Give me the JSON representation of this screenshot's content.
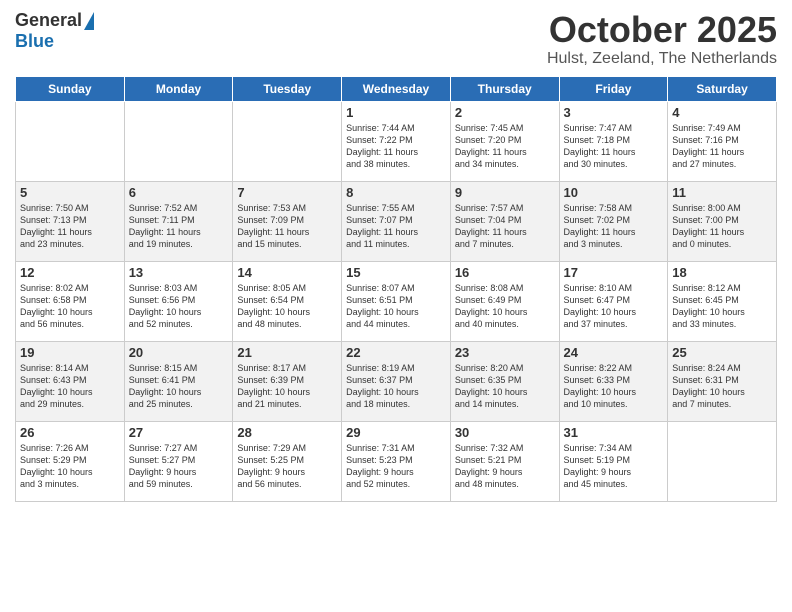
{
  "header": {
    "logo_general": "General",
    "logo_blue": "Blue",
    "month_title": "October 2025",
    "location": "Hulst, Zeeland, The Netherlands"
  },
  "days_of_week": [
    "Sunday",
    "Monday",
    "Tuesday",
    "Wednesday",
    "Thursday",
    "Friday",
    "Saturday"
  ],
  "weeks": [
    [
      {
        "day": "",
        "info": ""
      },
      {
        "day": "",
        "info": ""
      },
      {
        "day": "",
        "info": ""
      },
      {
        "day": "1",
        "info": "Sunrise: 7:44 AM\nSunset: 7:22 PM\nDaylight: 11 hours\nand 38 minutes."
      },
      {
        "day": "2",
        "info": "Sunrise: 7:45 AM\nSunset: 7:20 PM\nDaylight: 11 hours\nand 34 minutes."
      },
      {
        "day": "3",
        "info": "Sunrise: 7:47 AM\nSunset: 7:18 PM\nDaylight: 11 hours\nand 30 minutes."
      },
      {
        "day": "4",
        "info": "Sunrise: 7:49 AM\nSunset: 7:16 PM\nDaylight: 11 hours\nand 27 minutes."
      }
    ],
    [
      {
        "day": "5",
        "info": "Sunrise: 7:50 AM\nSunset: 7:13 PM\nDaylight: 11 hours\nand 23 minutes."
      },
      {
        "day": "6",
        "info": "Sunrise: 7:52 AM\nSunset: 7:11 PM\nDaylight: 11 hours\nand 19 minutes."
      },
      {
        "day": "7",
        "info": "Sunrise: 7:53 AM\nSunset: 7:09 PM\nDaylight: 11 hours\nand 15 minutes."
      },
      {
        "day": "8",
        "info": "Sunrise: 7:55 AM\nSunset: 7:07 PM\nDaylight: 11 hours\nand 11 minutes."
      },
      {
        "day": "9",
        "info": "Sunrise: 7:57 AM\nSunset: 7:04 PM\nDaylight: 11 hours\nand 7 minutes."
      },
      {
        "day": "10",
        "info": "Sunrise: 7:58 AM\nSunset: 7:02 PM\nDaylight: 11 hours\nand 3 minutes."
      },
      {
        "day": "11",
        "info": "Sunrise: 8:00 AM\nSunset: 7:00 PM\nDaylight: 11 hours\nand 0 minutes."
      }
    ],
    [
      {
        "day": "12",
        "info": "Sunrise: 8:02 AM\nSunset: 6:58 PM\nDaylight: 10 hours\nand 56 minutes."
      },
      {
        "day": "13",
        "info": "Sunrise: 8:03 AM\nSunset: 6:56 PM\nDaylight: 10 hours\nand 52 minutes."
      },
      {
        "day": "14",
        "info": "Sunrise: 8:05 AM\nSunset: 6:54 PM\nDaylight: 10 hours\nand 48 minutes."
      },
      {
        "day": "15",
        "info": "Sunrise: 8:07 AM\nSunset: 6:51 PM\nDaylight: 10 hours\nand 44 minutes."
      },
      {
        "day": "16",
        "info": "Sunrise: 8:08 AM\nSunset: 6:49 PM\nDaylight: 10 hours\nand 40 minutes."
      },
      {
        "day": "17",
        "info": "Sunrise: 8:10 AM\nSunset: 6:47 PM\nDaylight: 10 hours\nand 37 minutes."
      },
      {
        "day": "18",
        "info": "Sunrise: 8:12 AM\nSunset: 6:45 PM\nDaylight: 10 hours\nand 33 minutes."
      }
    ],
    [
      {
        "day": "19",
        "info": "Sunrise: 8:14 AM\nSunset: 6:43 PM\nDaylight: 10 hours\nand 29 minutes."
      },
      {
        "day": "20",
        "info": "Sunrise: 8:15 AM\nSunset: 6:41 PM\nDaylight: 10 hours\nand 25 minutes."
      },
      {
        "day": "21",
        "info": "Sunrise: 8:17 AM\nSunset: 6:39 PM\nDaylight: 10 hours\nand 21 minutes."
      },
      {
        "day": "22",
        "info": "Sunrise: 8:19 AM\nSunset: 6:37 PM\nDaylight: 10 hours\nand 18 minutes."
      },
      {
        "day": "23",
        "info": "Sunrise: 8:20 AM\nSunset: 6:35 PM\nDaylight: 10 hours\nand 14 minutes."
      },
      {
        "day": "24",
        "info": "Sunrise: 8:22 AM\nSunset: 6:33 PM\nDaylight: 10 hours\nand 10 minutes."
      },
      {
        "day": "25",
        "info": "Sunrise: 8:24 AM\nSunset: 6:31 PM\nDaylight: 10 hours\nand 7 minutes."
      }
    ],
    [
      {
        "day": "26",
        "info": "Sunrise: 7:26 AM\nSunset: 5:29 PM\nDaylight: 10 hours\nand 3 minutes."
      },
      {
        "day": "27",
        "info": "Sunrise: 7:27 AM\nSunset: 5:27 PM\nDaylight: 9 hours\nand 59 minutes."
      },
      {
        "day": "28",
        "info": "Sunrise: 7:29 AM\nSunset: 5:25 PM\nDaylight: 9 hours\nand 56 minutes."
      },
      {
        "day": "29",
        "info": "Sunrise: 7:31 AM\nSunset: 5:23 PM\nDaylight: 9 hours\nand 52 minutes."
      },
      {
        "day": "30",
        "info": "Sunrise: 7:32 AM\nSunset: 5:21 PM\nDaylight: 9 hours\nand 48 minutes."
      },
      {
        "day": "31",
        "info": "Sunrise: 7:34 AM\nSunset: 5:19 PM\nDaylight: 9 hours\nand 45 minutes."
      },
      {
        "day": "",
        "info": ""
      }
    ]
  ]
}
